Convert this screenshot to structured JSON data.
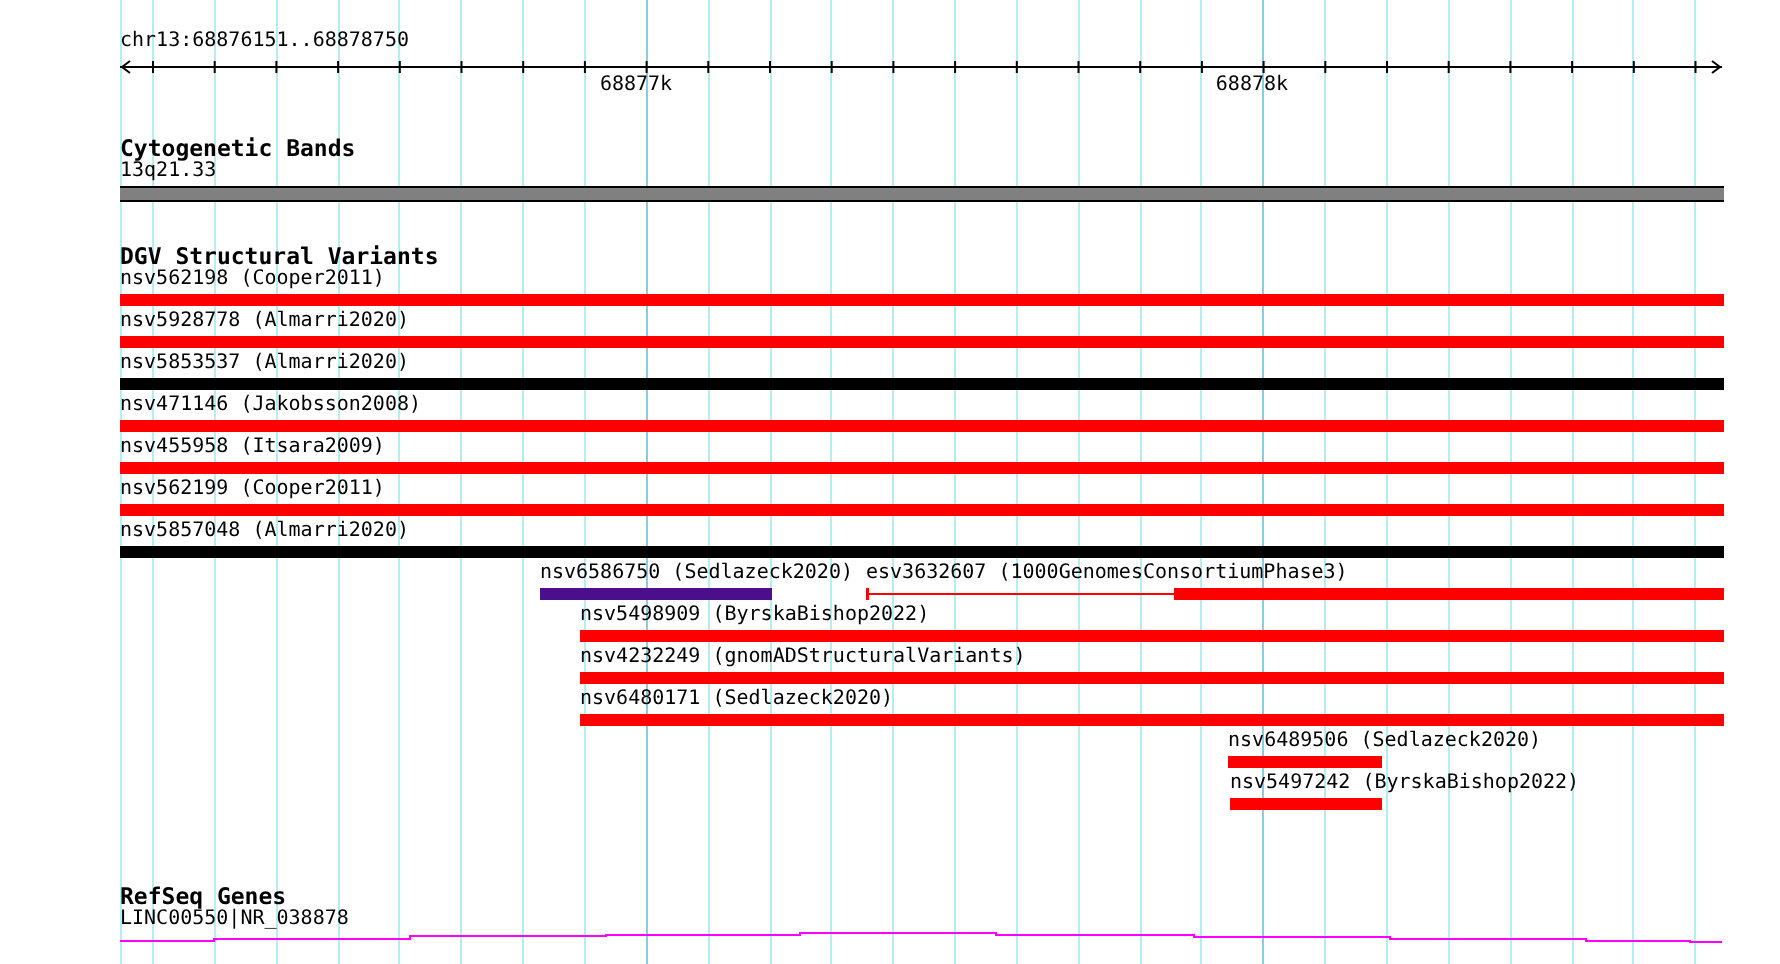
{
  "ruler": {
    "location": "chr13:68876151..68878750",
    "tick_labels": [
      "68877k",
      "68878k"
    ]
  },
  "cytobands": {
    "title": "Cytogenetic Bands",
    "label": "13q21.33"
  },
  "variants": {
    "title": "DGV Structural Variants",
    "rows": [
      [
        {
          "label": "nsv562198 (Cooper2011)",
          "color": "#ff0000",
          "kind": "bar"
        }
      ],
      [
        {
          "label": "nsv5928778 (Almarri2020)",
          "color": "#ff0000",
          "kind": "bar"
        }
      ],
      [
        {
          "label": "nsv5853537 (Almarri2020)",
          "color": "#000000",
          "kind": "bar"
        }
      ],
      [
        {
          "label": "nsv471146 (Jakobsson2008)",
          "color": "#ff0000",
          "kind": "bar"
        }
      ],
      [
        {
          "label": "nsv455958 (Itsara2009)",
          "color": "#ff0000",
          "kind": "bar"
        }
      ],
      [
        {
          "label": "nsv562199 (Cooper2011)",
          "color": "#ff0000",
          "kind": "bar"
        }
      ],
      [
        {
          "label": "nsv5857048 (Almarri2020)",
          "color": "#000000",
          "kind": "bar"
        }
      ],
      [
        {
          "label": "nsv6586750 (Sedlazeck2020)",
          "color": "#4b0f8c",
          "kind": "bar"
        },
        {
          "label": "esv3632607 (1000GenomesConsortiumPhase3)",
          "color": "#ff0000",
          "kind": "split"
        }
      ],
      [
        {
          "label": "nsv5498909 (ByrskaBishop2022)",
          "color": "#ff0000",
          "kind": "bar"
        }
      ],
      [
        {
          "label": "nsv4232249 (gnomADStructuralVariants)",
          "color": "#ff0000",
          "kind": "bar"
        }
      ],
      [
        {
          "label": "nsv6480171 (Sedlazeck2020)",
          "color": "#ff0000",
          "kind": "bar"
        }
      ],
      [
        {
          "label": "nsv6489506 (Sedlazeck2020)",
          "color": "#ff0000",
          "kind": "bar"
        }
      ],
      [
        {
          "label": "nsv5497242 (ByrskaBishop2022)",
          "color": "#ff0000",
          "kind": "bar"
        }
      ]
    ]
  },
  "genes": {
    "title": "RefSeq Genes",
    "label": "LINC00550|NR_038878"
  }
}
